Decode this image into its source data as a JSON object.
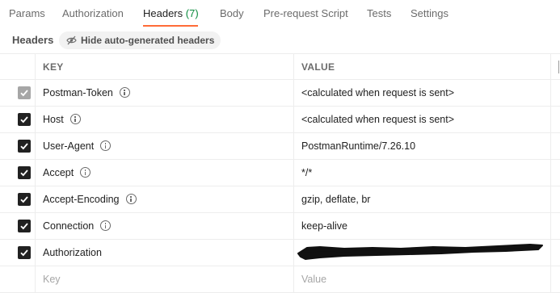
{
  "tabs": [
    {
      "label": "Params"
    },
    {
      "label": "Authorization"
    },
    {
      "label": "Headers",
      "count": "(7)",
      "active": true
    },
    {
      "label": "Body"
    },
    {
      "label": "Pre-request Script"
    },
    {
      "label": "Tests"
    },
    {
      "label": "Settings"
    }
  ],
  "toolbar": {
    "title": "Headers",
    "hide_label": "Hide auto-generated headers"
  },
  "table": {
    "columns": {
      "key": "KEY",
      "value": "VALUE"
    },
    "rows": [
      {
        "key": "Postman-Token",
        "value": "<calculated when request is sent>",
        "checked": true,
        "disabled": true,
        "info": true
      },
      {
        "key": "Host",
        "value": "<calculated when request is sent>",
        "checked": true,
        "disabled": false,
        "info": true
      },
      {
        "key": "User-Agent",
        "value": "PostmanRuntime/7.26.10",
        "checked": true,
        "disabled": false,
        "info": true
      },
      {
        "key": "Accept",
        "value": "*/*",
        "checked": true,
        "disabled": false,
        "info": true
      },
      {
        "key": "Accept-Encoding",
        "value": "gzip, deflate, br",
        "checked": true,
        "disabled": false,
        "info": true
      },
      {
        "key": "Connection",
        "value": "keep-alive",
        "checked": true,
        "disabled": false,
        "info": true
      },
      {
        "key": "Authorization",
        "value": "",
        "checked": true,
        "disabled": false,
        "info": false,
        "redacted": true
      }
    ],
    "new_row": {
      "key_placeholder": "Key",
      "value_placeholder": "Value"
    }
  },
  "colors": {
    "accent": "#ff6c37",
    "count": "#0a8a3d"
  }
}
